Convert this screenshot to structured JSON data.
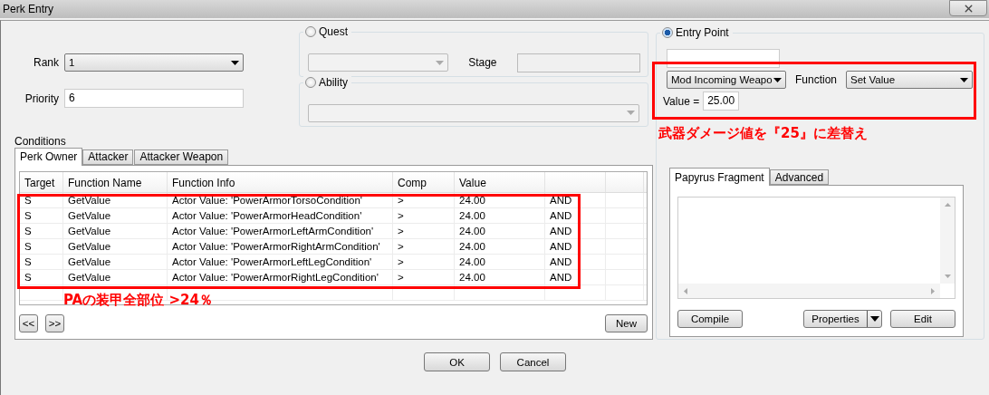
{
  "window": {
    "title": "Perk Entry"
  },
  "rank": {
    "label": "Rank",
    "value": "1"
  },
  "priority": {
    "label": "Priority",
    "value": "6"
  },
  "quest": {
    "label": "Quest",
    "selected": false,
    "stage_label": "Stage"
  },
  "ability": {
    "label": "Ability",
    "selected": false
  },
  "entry_point": {
    "label": "Entry Point",
    "selected": true,
    "point": "Mod Incoming Weapo",
    "function_label": "Function",
    "function": "Set Value",
    "value_label": "Value =",
    "value": "25.00"
  },
  "conditions": {
    "title": "Conditions",
    "tabs": [
      {
        "label": "Perk Owner",
        "selected": true
      },
      {
        "label": "Attacker",
        "selected": false
      },
      {
        "label": "Attacker Weapon",
        "selected": false
      }
    ],
    "columns": [
      "Target",
      "Function Name",
      "Function Info",
      "Comp",
      "Value"
    ],
    "rows": [
      [
        "S",
        "GetValue",
        "Actor Value: 'PowerArmorTorsoCondition'",
        ">",
        "24.00",
        "AND"
      ],
      [
        "S",
        "GetValue",
        "Actor Value: 'PowerArmorHeadCondition'",
        ">",
        "24.00",
        "AND"
      ],
      [
        "S",
        "GetValue",
        "Actor Value: 'PowerArmorLeftArmCondition'",
        ">",
        "24.00",
        "AND"
      ],
      [
        "S",
        "GetValue",
        "Actor Value: 'PowerArmorRightArmCondition'",
        ">",
        "24.00",
        "AND"
      ],
      [
        "S",
        "GetValue",
        "Actor Value: 'PowerArmorLeftLegCondition'",
        ">",
        "24.00",
        "AND"
      ],
      [
        "S",
        "GetValue",
        "Actor Value: 'PowerArmorRightLegCondition'",
        ">",
        "24.00",
        "AND"
      ]
    ],
    "nav_buttons": [
      "<<",
      ">>"
    ],
    "new_button": "New"
  },
  "script": {
    "tabs": [
      {
        "label": "Papyrus Fragment",
        "selected": true
      },
      {
        "label": "Advanced",
        "selected": false
      }
    ],
    "compile": "Compile",
    "properties": "Properties",
    "edit": "Edit"
  },
  "annotations": [
    {
      "text": "武器ダメージ値を『25』に差替え"
    },
    {
      "text": "PAの装甲全部位 >24％"
    }
  ],
  "buttons": [
    "OK",
    "Cancel"
  ]
}
